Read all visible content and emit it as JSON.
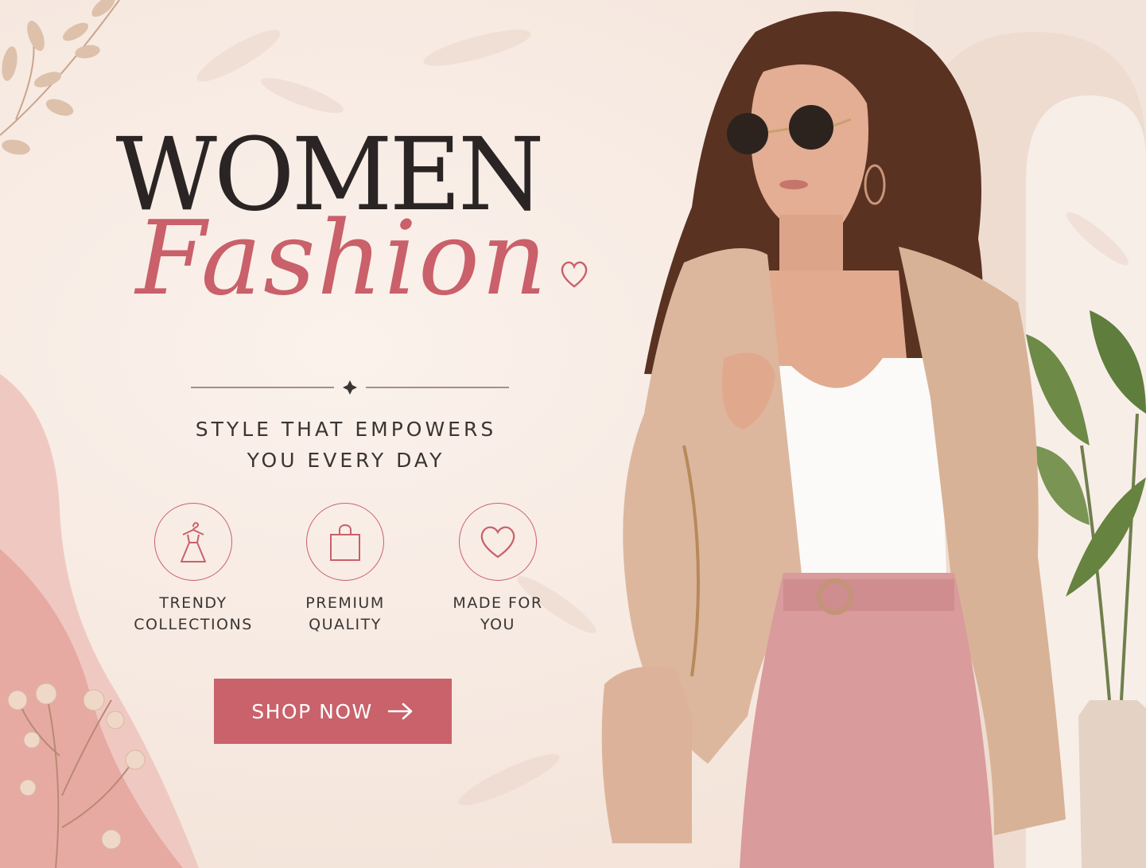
{
  "hero": {
    "title_line1": "WOMEN",
    "title_line2": "Fashion",
    "tagline_line1": "STYLE THAT EMPOWERS",
    "tagline_line2": "YOU EVERY DAY"
  },
  "features": [
    {
      "icon": "dress-hanger-icon",
      "line1": "TRENDY",
      "line2": "COLLECTIONS"
    },
    {
      "icon": "shopping-bag-icon",
      "line1": "PREMIUM",
      "line2": "QUALITY"
    },
    {
      "icon": "heart-icon",
      "line1": "MADE FOR",
      "line2": "YOU"
    }
  ],
  "cta": {
    "label": "SHOP NOW",
    "icon": "arrow-right-icon"
  },
  "colors": {
    "accent": "#c9626b",
    "background": "#f7ece4",
    "text_dark": "#2a2524",
    "blazer": "#dcb79e",
    "trousers": "#d99b9c"
  }
}
